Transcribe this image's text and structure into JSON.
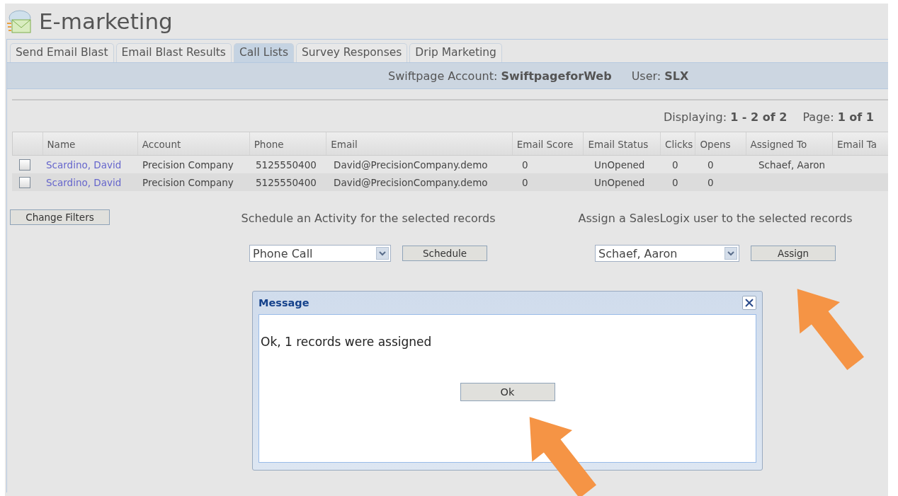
{
  "header": {
    "title": "E-marketing"
  },
  "tabs": [
    {
      "label": "Send Email Blast",
      "selected": false
    },
    {
      "label": "Email Blast Results",
      "selected": false
    },
    {
      "label": "Call Lists",
      "selected": true
    },
    {
      "label": "Survey Responses",
      "selected": false
    },
    {
      "label": "Drip Marketing",
      "selected": false
    }
  ],
  "account_bar": {
    "account_label": "Swiftpage Account:",
    "account": "SwiftpageforWeb",
    "user_label": "User:",
    "user": "SLX"
  },
  "pagination": {
    "displaying_label": "Displaying:",
    "displaying": "1 - 2 of 2",
    "page_label": "Page:",
    "page": "1 of 1"
  },
  "table": {
    "columns": [
      "Name",
      "Account",
      "Phone",
      "Email",
      "Email Score",
      "Email Status",
      "Clicks",
      "Opens",
      "Assigned To",
      "Email Ta"
    ],
    "rows": [
      {
        "checked": false,
        "cells": [
          "Scardino, David",
          "Precision Company",
          "5125550400",
          "David@PrecisionCompany.demo",
          "0",
          "UnOpened",
          "0",
          "0",
          "Schaef, Aaron",
          ""
        ]
      },
      {
        "checked": false,
        "cells": [
          "Scardino, David",
          "Precision Company",
          "5125550400",
          "David@PrecisionCompany.demo",
          "0",
          "UnOpened",
          "0",
          "0",
          "",
          ""
        ]
      }
    ]
  },
  "filters_button": "Change Filters",
  "schedule": {
    "caption": "Schedule an Activity for the selected records",
    "value": "Phone Call",
    "button": "Schedule"
  },
  "assign": {
    "caption": "Assign a SalesLogix user to the selected records",
    "value": "Schaef, Aaron",
    "button": "Assign"
  },
  "dialog": {
    "title": "Message",
    "message": "Ok, 1 records were assigned",
    "button": "Ok"
  }
}
